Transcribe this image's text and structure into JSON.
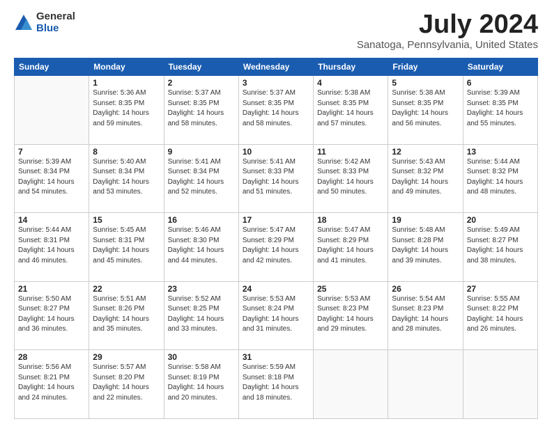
{
  "header": {
    "logo_general": "General",
    "logo_blue": "Blue",
    "month_title": "July 2024",
    "location": "Sanatoga, Pennsylvania, United States"
  },
  "days_of_week": [
    "Sunday",
    "Monday",
    "Tuesday",
    "Wednesday",
    "Thursday",
    "Friday",
    "Saturday"
  ],
  "weeks": [
    [
      {
        "day": "",
        "info": ""
      },
      {
        "day": "1",
        "info": "Sunrise: 5:36 AM\nSunset: 8:35 PM\nDaylight: 14 hours\nand 59 minutes."
      },
      {
        "day": "2",
        "info": "Sunrise: 5:37 AM\nSunset: 8:35 PM\nDaylight: 14 hours\nand 58 minutes."
      },
      {
        "day": "3",
        "info": "Sunrise: 5:37 AM\nSunset: 8:35 PM\nDaylight: 14 hours\nand 58 minutes."
      },
      {
        "day": "4",
        "info": "Sunrise: 5:38 AM\nSunset: 8:35 PM\nDaylight: 14 hours\nand 57 minutes."
      },
      {
        "day": "5",
        "info": "Sunrise: 5:38 AM\nSunset: 8:35 PM\nDaylight: 14 hours\nand 56 minutes."
      },
      {
        "day": "6",
        "info": "Sunrise: 5:39 AM\nSunset: 8:35 PM\nDaylight: 14 hours\nand 55 minutes."
      }
    ],
    [
      {
        "day": "7",
        "info": "Sunrise: 5:39 AM\nSunset: 8:34 PM\nDaylight: 14 hours\nand 54 minutes."
      },
      {
        "day": "8",
        "info": "Sunrise: 5:40 AM\nSunset: 8:34 PM\nDaylight: 14 hours\nand 53 minutes."
      },
      {
        "day": "9",
        "info": "Sunrise: 5:41 AM\nSunset: 8:34 PM\nDaylight: 14 hours\nand 52 minutes."
      },
      {
        "day": "10",
        "info": "Sunrise: 5:41 AM\nSunset: 8:33 PM\nDaylight: 14 hours\nand 51 minutes."
      },
      {
        "day": "11",
        "info": "Sunrise: 5:42 AM\nSunset: 8:33 PM\nDaylight: 14 hours\nand 50 minutes."
      },
      {
        "day": "12",
        "info": "Sunrise: 5:43 AM\nSunset: 8:32 PM\nDaylight: 14 hours\nand 49 minutes."
      },
      {
        "day": "13",
        "info": "Sunrise: 5:44 AM\nSunset: 8:32 PM\nDaylight: 14 hours\nand 48 minutes."
      }
    ],
    [
      {
        "day": "14",
        "info": "Sunrise: 5:44 AM\nSunset: 8:31 PM\nDaylight: 14 hours\nand 46 minutes."
      },
      {
        "day": "15",
        "info": "Sunrise: 5:45 AM\nSunset: 8:31 PM\nDaylight: 14 hours\nand 45 minutes."
      },
      {
        "day": "16",
        "info": "Sunrise: 5:46 AM\nSunset: 8:30 PM\nDaylight: 14 hours\nand 44 minutes."
      },
      {
        "day": "17",
        "info": "Sunrise: 5:47 AM\nSunset: 8:29 PM\nDaylight: 14 hours\nand 42 minutes."
      },
      {
        "day": "18",
        "info": "Sunrise: 5:47 AM\nSunset: 8:29 PM\nDaylight: 14 hours\nand 41 minutes."
      },
      {
        "day": "19",
        "info": "Sunrise: 5:48 AM\nSunset: 8:28 PM\nDaylight: 14 hours\nand 39 minutes."
      },
      {
        "day": "20",
        "info": "Sunrise: 5:49 AM\nSunset: 8:27 PM\nDaylight: 14 hours\nand 38 minutes."
      }
    ],
    [
      {
        "day": "21",
        "info": "Sunrise: 5:50 AM\nSunset: 8:27 PM\nDaylight: 14 hours\nand 36 minutes."
      },
      {
        "day": "22",
        "info": "Sunrise: 5:51 AM\nSunset: 8:26 PM\nDaylight: 14 hours\nand 35 minutes."
      },
      {
        "day": "23",
        "info": "Sunrise: 5:52 AM\nSunset: 8:25 PM\nDaylight: 14 hours\nand 33 minutes."
      },
      {
        "day": "24",
        "info": "Sunrise: 5:53 AM\nSunset: 8:24 PM\nDaylight: 14 hours\nand 31 minutes."
      },
      {
        "day": "25",
        "info": "Sunrise: 5:53 AM\nSunset: 8:23 PM\nDaylight: 14 hours\nand 29 minutes."
      },
      {
        "day": "26",
        "info": "Sunrise: 5:54 AM\nSunset: 8:23 PM\nDaylight: 14 hours\nand 28 minutes."
      },
      {
        "day": "27",
        "info": "Sunrise: 5:55 AM\nSunset: 8:22 PM\nDaylight: 14 hours\nand 26 minutes."
      }
    ],
    [
      {
        "day": "28",
        "info": "Sunrise: 5:56 AM\nSunset: 8:21 PM\nDaylight: 14 hours\nand 24 minutes."
      },
      {
        "day": "29",
        "info": "Sunrise: 5:57 AM\nSunset: 8:20 PM\nDaylight: 14 hours\nand 22 minutes."
      },
      {
        "day": "30",
        "info": "Sunrise: 5:58 AM\nSunset: 8:19 PM\nDaylight: 14 hours\nand 20 minutes."
      },
      {
        "day": "31",
        "info": "Sunrise: 5:59 AM\nSunset: 8:18 PM\nDaylight: 14 hours\nand 18 minutes."
      },
      {
        "day": "",
        "info": ""
      },
      {
        "day": "",
        "info": ""
      },
      {
        "day": "",
        "info": ""
      }
    ]
  ]
}
